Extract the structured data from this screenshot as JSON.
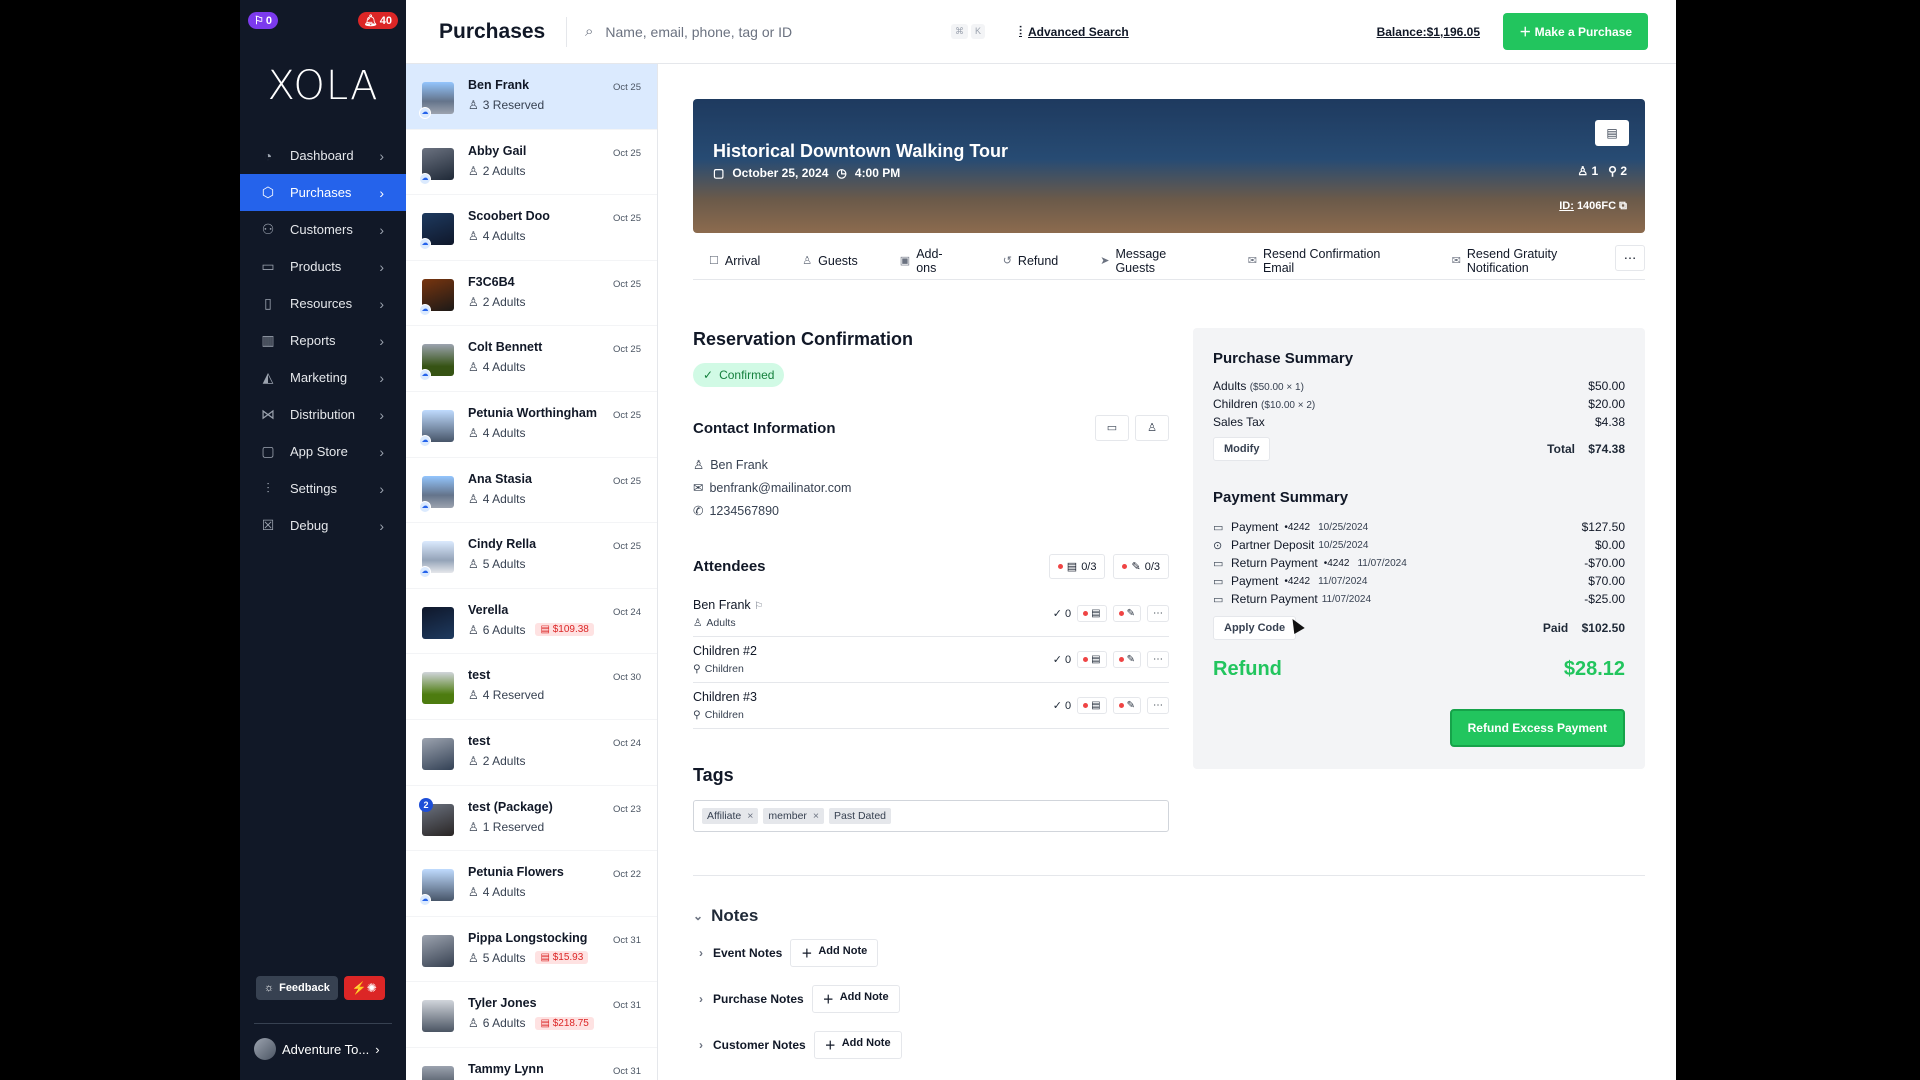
{
  "sidebar": {
    "notif_count": "0",
    "alert_count": "40",
    "logo": "XOLA",
    "items": [
      {
        "label": "Dashboard"
      },
      {
        "label": "Purchases"
      },
      {
        "label": "Customers"
      },
      {
        "label": "Products"
      },
      {
        "label": "Resources"
      },
      {
        "label": "Reports"
      },
      {
        "label": "Marketing"
      },
      {
        "label": "Distribution"
      },
      {
        "label": "App Store"
      },
      {
        "label": "Settings"
      },
      {
        "label": "Debug"
      }
    ],
    "feedback_label": "Feedback",
    "account_label": "Adventure To..."
  },
  "header": {
    "title": "Purchases",
    "search_placeholder": "Name, email, phone, tag or ID",
    "advanced_search": "Advanced Search",
    "balance": "Balance:$1,196.05",
    "make_purchase": "Make a Purchase"
  },
  "purchases": [
    {
      "name": "Ben Frank",
      "sub": "3 Reserved",
      "date": "Oct 25",
      "badge": ""
    },
    {
      "name": "Abby Gail",
      "sub": "2 Adults",
      "date": "Oct 25",
      "badge": ""
    },
    {
      "name": "Scoobert Doo",
      "sub": "4 Adults",
      "date": "Oct 25",
      "badge": ""
    },
    {
      "name": "F3C6B4",
      "sub": "2 Adults",
      "date": "Oct 25",
      "badge": ""
    },
    {
      "name": "Colt Bennett",
      "sub": "4 Adults",
      "date": "Oct 25",
      "badge": ""
    },
    {
      "name": "Petunia Worthingham",
      "sub": "4 Adults",
      "date": "Oct 25",
      "badge": ""
    },
    {
      "name": "Ana Stasia",
      "sub": "4 Adults",
      "date": "Oct 25",
      "badge": ""
    },
    {
      "name": "Cindy Rella",
      "sub": "5 Adults",
      "date": "Oct 25",
      "badge": ""
    },
    {
      "name": "Verella",
      "sub": "6 Adults",
      "date": "Oct 24",
      "badge": "$109.38"
    },
    {
      "name": "test",
      "sub": "4 Reserved",
      "date": "Oct 30",
      "badge": ""
    },
    {
      "name": "test",
      "sub": "2 Adults",
      "date": "Oct 24",
      "badge": ""
    },
    {
      "name": "test (Package)",
      "sub": "1 Reserved",
      "date": "Oct 23",
      "badge": "",
      "count": "2"
    },
    {
      "name": "Petunia Flowers",
      "sub": "4 Adults",
      "date": "Oct 22",
      "badge": ""
    },
    {
      "name": "Pippa Longstocking",
      "sub": "5 Adults",
      "date": "Oct 31",
      "badge": "$15.93"
    },
    {
      "name": "Tyler Jones",
      "sub": "6 Adults",
      "date": "Oct 31",
      "badge": "$218.75"
    },
    {
      "name": "Tammy Lynn",
      "sub": "",
      "date": "Oct 31",
      "badge": ""
    }
  ],
  "event": {
    "title": "Historical Downtown Walking Tour",
    "date": "October 25, 2024",
    "time": "4:00 PM",
    "guests": "1",
    "pins": "2",
    "id_label": "ID:",
    "id_value": "1406FC"
  },
  "tabs": [
    {
      "label": "Arrival"
    },
    {
      "label": "Guests"
    },
    {
      "label": "Add-ons"
    },
    {
      "label": "Refund"
    },
    {
      "label": "Message Guests"
    },
    {
      "label": "Resend Confirmation Email"
    },
    {
      "label": "Resend Gratuity Notification"
    }
  ],
  "reservation": {
    "title": "Reservation Confirmation",
    "status": "Confirmed"
  },
  "contact": {
    "title": "Contact Information",
    "name": "Ben Frank",
    "email": "benfrank@mailinator.com",
    "phone": "1234567890"
  },
  "attendees": {
    "title": "Attendees",
    "counter1": "0/3",
    "counter2": "0/3",
    "rows": [
      {
        "name": "Ben Frank",
        "type": "Adults",
        "checks": "0"
      },
      {
        "name": "Children #2",
        "type": "Children",
        "checks": "0"
      },
      {
        "name": "Children #3",
        "type": "Children",
        "checks": "0"
      }
    ]
  },
  "tags": {
    "title": "Tags",
    "items": [
      "Affiliate",
      "member",
      "Past Dated"
    ]
  },
  "notes": {
    "title": "Notes",
    "rows": [
      {
        "label": "Event Notes",
        "btn": "Add Note"
      },
      {
        "label": "Purchase Notes",
        "btn": "Add Note"
      },
      {
        "label": "Customer Notes",
        "btn": "Add Note"
      }
    ]
  },
  "purchase_summary": {
    "title": "Purchase Summary",
    "lines": [
      {
        "label": "Adults",
        "detail": "($50.00 × 1)",
        "amount": "$50.00"
      },
      {
        "label": "Children",
        "detail": "($10.00 × 2)",
        "amount": "$20.00"
      },
      {
        "label": "Sales Tax",
        "detail": "",
        "amount": "$4.38"
      }
    ],
    "modify": "Modify",
    "total_label": "Total",
    "total": "$74.38"
  },
  "payment_summary": {
    "title": "Payment Summary",
    "lines": [
      {
        "label": "Payment",
        "card": "•4242",
        "date": "10/25/2024",
        "amount": "$127.50"
      },
      {
        "label": "Partner Deposit",
        "card": "",
        "date": "10/25/2024",
        "amount": "$0.00"
      },
      {
        "label": "Return Payment",
        "card": "•4242",
        "date": "11/07/2024",
        "amount": "-$70.00"
      },
      {
        "label": "Payment",
        "card": "•4242",
        "date": "11/07/2024",
        "amount": "$70.00"
      },
      {
        "label": "Return Payment",
        "card": "",
        "date": "11/07/2024",
        "amount": "-$25.00"
      }
    ],
    "apply_code": "Apply Code",
    "paid_label": "Paid",
    "paid": "$102.50",
    "refund_label": "Refund",
    "refund": "$28.12",
    "refund_btn": "Refund Excess Payment"
  }
}
